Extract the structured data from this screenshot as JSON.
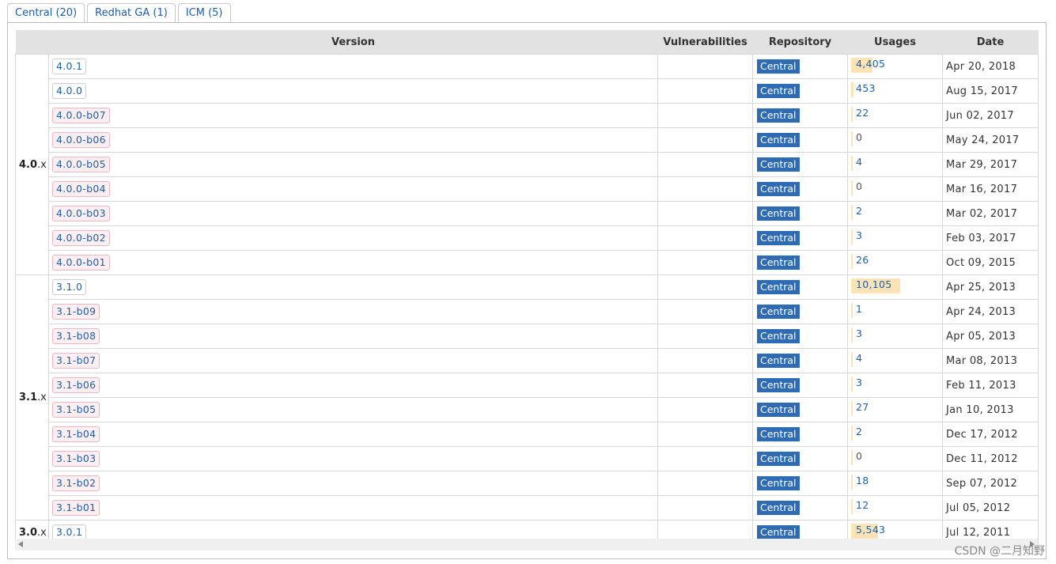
{
  "tabs": [
    {
      "label": "Central (20)"
    },
    {
      "label": "Redhat GA (1)"
    },
    {
      "label": "ICM (5)"
    }
  ],
  "columns": {
    "version": "Version",
    "vulnerabilities": "Vulnerabilities",
    "repository": "Repository",
    "usages": "Usages",
    "date": "Date"
  },
  "groups": [
    {
      "major": "4.0",
      "suffix": ".x",
      "rows": [
        {
          "version": "4.0.1",
          "prerelease": false,
          "repo": "Central",
          "usages": "4,405",
          "usage_fraction": 0.44,
          "date": "Apr 20, 2018"
        },
        {
          "version": "4.0.0",
          "prerelease": false,
          "repo": "Central",
          "usages": "453",
          "usage_fraction": 0.045,
          "date": "Aug 15, 2017"
        },
        {
          "version": "4.0.0-b07",
          "prerelease": true,
          "repo": "Central",
          "usages": "22",
          "usage_fraction": 0.002,
          "date": "Jun 02, 2017"
        },
        {
          "version": "4.0.0-b06",
          "prerelease": true,
          "repo": "Central",
          "usages": "0",
          "usage_fraction": 0,
          "date": "May 24, 2017"
        },
        {
          "version": "4.0.0-b05",
          "prerelease": true,
          "repo": "Central",
          "usages": "4",
          "usage_fraction": 0.0004,
          "date": "Mar 29, 2017"
        },
        {
          "version": "4.0.0-b04",
          "prerelease": true,
          "repo": "Central",
          "usages": "0",
          "usage_fraction": 0,
          "date": "Mar 16, 2017"
        },
        {
          "version": "4.0.0-b03",
          "prerelease": true,
          "repo": "Central",
          "usages": "2",
          "usage_fraction": 0.0002,
          "date": "Mar 02, 2017"
        },
        {
          "version": "4.0.0-b02",
          "prerelease": true,
          "repo": "Central",
          "usages": "3",
          "usage_fraction": 0.0003,
          "date": "Feb 03, 2017"
        },
        {
          "version": "4.0.0-b01",
          "prerelease": true,
          "repo": "Central",
          "usages": "26",
          "usage_fraction": 0.0026,
          "date": "Oct 09, 2015"
        }
      ]
    },
    {
      "major": "3.1",
      "suffix": ".x",
      "rows": [
        {
          "version": "3.1.0",
          "prerelease": false,
          "repo": "Central",
          "usages": "10,105",
          "usage_fraction": 1.0,
          "date": "Apr 25, 2013"
        },
        {
          "version": "3.1-b09",
          "prerelease": true,
          "repo": "Central",
          "usages": "1",
          "usage_fraction": 0.0001,
          "date": "Apr 24, 2013"
        },
        {
          "version": "3.1-b08",
          "prerelease": true,
          "repo": "Central",
          "usages": "3",
          "usage_fraction": 0.0003,
          "date": "Apr 05, 2013"
        },
        {
          "version": "3.1-b07",
          "prerelease": true,
          "repo": "Central",
          "usages": "4",
          "usage_fraction": 0.0004,
          "date": "Mar 08, 2013"
        },
        {
          "version": "3.1-b06",
          "prerelease": true,
          "repo": "Central",
          "usages": "3",
          "usage_fraction": 0.0003,
          "date": "Feb 11, 2013"
        },
        {
          "version": "3.1-b05",
          "prerelease": true,
          "repo": "Central",
          "usages": "27",
          "usage_fraction": 0.0027,
          "date": "Jan 10, 2013"
        },
        {
          "version": "3.1-b04",
          "prerelease": true,
          "repo": "Central",
          "usages": "2",
          "usage_fraction": 0.0002,
          "date": "Dec 17, 2012"
        },
        {
          "version": "3.1-b03",
          "prerelease": true,
          "repo": "Central",
          "usages": "0",
          "usage_fraction": 0,
          "date": "Dec 11, 2012"
        },
        {
          "version": "3.1-b02",
          "prerelease": true,
          "repo": "Central",
          "usages": "18",
          "usage_fraction": 0.0018,
          "date": "Sep 07, 2012"
        },
        {
          "version": "3.1-b01",
          "prerelease": true,
          "repo": "Central",
          "usages": "12",
          "usage_fraction": 0.0012,
          "date": "Jul 05, 2012"
        }
      ]
    },
    {
      "major": "3.0",
      "suffix": ".x",
      "rows": [
        {
          "version": "3.0.1",
          "prerelease": false,
          "repo": "Central",
          "usages": "5,543",
          "usage_fraction": 0.55,
          "date": "Jul 12, 2011"
        }
      ]
    }
  ],
  "watermark": "CSDN @二月知野",
  "colors": {
    "link": "#1e5fa8",
    "repo_badge": "#2e6bb2",
    "usage_bar": "#fde3b5",
    "prerelease_bg": "#fdeef2"
  }
}
